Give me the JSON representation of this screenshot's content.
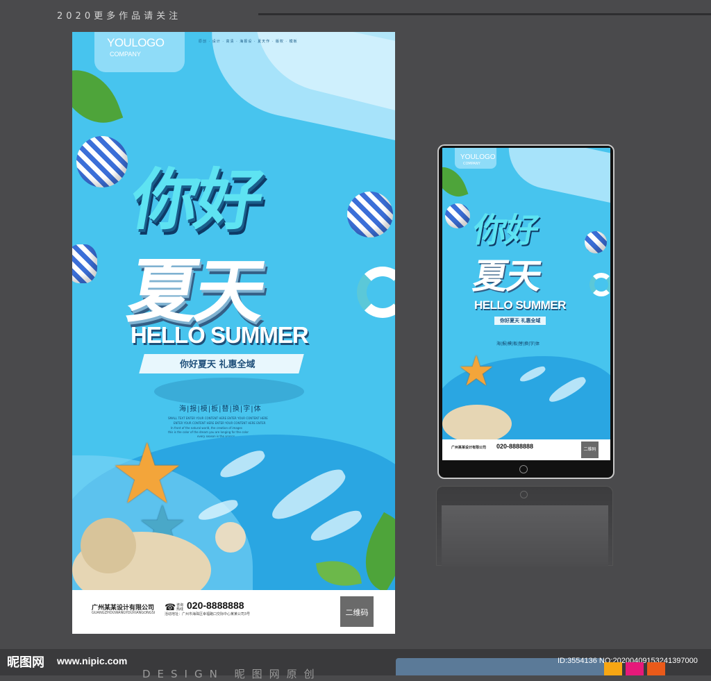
{
  "header": {
    "caption": "2020更多作品请关注"
  },
  "poster": {
    "logo": "YOULOGO",
    "logo_sub": "COMPANY",
    "nav_strip": "原创 · 设计 · 高清 · 海报设 · 夏天作 · 版权 · 模板",
    "title_line1": "你好",
    "title_line2": "夏天",
    "subtitle_en": "HELLO SUMMER",
    "ribbon_text": "你好夏天 礼惠全域",
    "template_title": "海|报|模|板|替|换|字|体",
    "fine_print": [
      "SMALL TEXT ENTER YOUR CONTENT HERE ENTER YOUR CONTENT HERE",
      "ENTER YOUR CONTENT HERE ENTER YOUR CONTENT HERE ENTER",
      "In front of the natural world, the creation of images",
      "this is the color of the dream you are longing for the color",
      "every season is the season"
    ],
    "company_cn": "广州某某设计有限公司",
    "company_en": "GUANGZHOUWANGYOUXIANGONGSI",
    "tel_label": "咨询热线",
    "phone": "020-8888888",
    "address": "活动地址：广州市海珠区幸福路口交际中心某某公司3号",
    "qr_label": "二维码"
  },
  "phone_mockup": {
    "logo": "YOULOGO",
    "logo_sub": "COMPANY",
    "title_line1": "你好",
    "title_line2": "夏天",
    "subtitle_en": "HELLO SUMMER",
    "ribbon_text": "你好夏天 礼惠全域",
    "template_title": "海|报|模|板|替|换|字|体",
    "company_cn": "广州某某设计有限公司",
    "phone": "020-8888888",
    "qr_label": "二维码"
  },
  "watermark": {
    "logo": "昵图网",
    "url": "www.nipic.com",
    "design": "DESIGN 昵图网原创",
    "id_text": "ID:3554136 NO:20200409153241397000"
  },
  "colors": {
    "swatches": [
      "#f7a613",
      "#e6197a",
      "#ea5a1a"
    ]
  }
}
